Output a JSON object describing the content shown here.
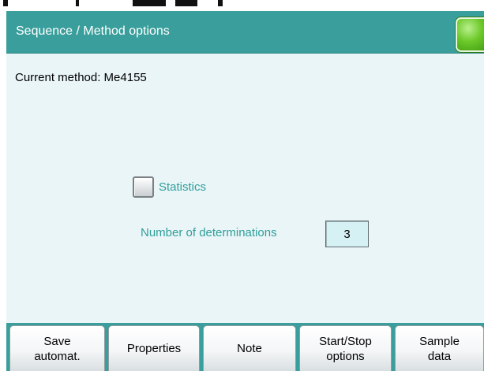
{
  "window": {
    "title": "Sequence / Method options",
    "status_indicator_color": "#6cc829"
  },
  "main": {
    "current_method": "Current method: Me4155",
    "statistics": {
      "label": "Statistics",
      "checked": false
    },
    "determinations": {
      "label": "Number of determinations",
      "value": "3"
    }
  },
  "function_keys": [
    {
      "label": "Save\nautomat."
    },
    {
      "label": "Properties"
    },
    {
      "label": "Note"
    },
    {
      "label": "Start/Stop\noptions"
    },
    {
      "label": "Sample\ndata"
    }
  ],
  "colors": {
    "accent": "#3a9f9c",
    "label_teal": "#2f9e99",
    "background": "#eaf5f8",
    "field_bg": "#d6f1f4"
  }
}
